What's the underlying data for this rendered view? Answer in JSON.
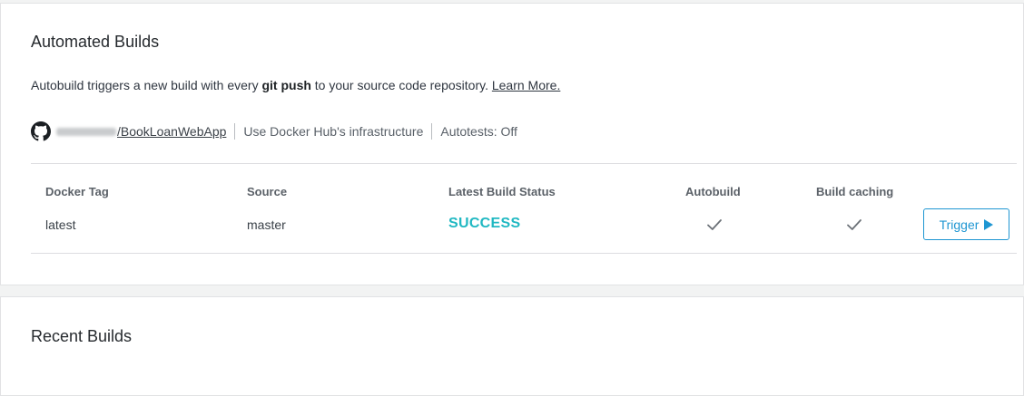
{
  "automated_builds": {
    "title": "Automated Builds",
    "description_prefix": "Autobuild triggers a new build with every ",
    "description_bold": "git push",
    "description_suffix": " to your source code repository. ",
    "learn_more": "Learn More.",
    "repo": {
      "icon": "github-icon",
      "name": "/BookLoanWebApp",
      "infrastructure": "Use Docker Hub's infrastructure",
      "autotests": "Autotests: Off"
    },
    "table": {
      "headers": {
        "tag": "Docker Tag",
        "source": "Source",
        "status": "Latest Build Status",
        "autobuild": "Autobuild",
        "caching": "Build caching"
      },
      "rows": [
        {
          "tag": "latest",
          "source": "master",
          "status": "SUCCESS",
          "autobuild": true,
          "caching": true,
          "trigger_label": "Trigger"
        }
      ]
    }
  },
  "recent_builds": {
    "title": "Recent Builds"
  },
  "colors": {
    "success": "#20b8c2",
    "primary": "#1e96d2"
  }
}
